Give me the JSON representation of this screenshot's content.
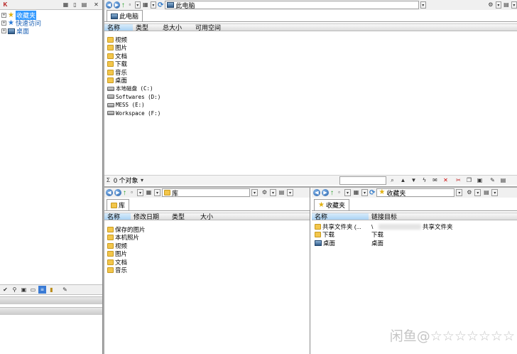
{
  "left_panel": {
    "tree": [
      {
        "label": "收藏夹",
        "icon": "star-icon",
        "selected": true
      },
      {
        "label": "快速访问",
        "icon": "quick-access-icon"
      },
      {
        "label": "桌面",
        "icon": "desktop-icon"
      }
    ]
  },
  "top_pane": {
    "address": "此电脑",
    "tab_label": "此电脑",
    "columns": [
      "名称",
      "类型",
      "总大小",
      "可用空间"
    ],
    "items": [
      {
        "name": "视频",
        "icon": "folder"
      },
      {
        "name": "图片",
        "icon": "folder"
      },
      {
        "name": "文档",
        "icon": "folder"
      },
      {
        "name": "下载",
        "icon": "folder"
      },
      {
        "name": "音乐",
        "icon": "folder"
      },
      {
        "name": "桌面",
        "icon": "folder"
      },
      {
        "name": "本地磁盘 (C:)",
        "icon": "drive"
      },
      {
        "name": "Softwares (D:)",
        "icon": "drive"
      },
      {
        "name": "MESS (E:)",
        "icon": "drive"
      },
      {
        "name": "Workspace (F:)",
        "icon": "drive"
      }
    ],
    "status": "0 个对象"
  },
  "bottom_left_pane": {
    "address": "库",
    "tab_label": "库",
    "columns": [
      "名称",
      "修改日期",
      "类型",
      "大小"
    ],
    "items": [
      "保存的图片",
      "本机照片",
      "视频",
      "图片",
      "文档",
      "音乐"
    ]
  },
  "bottom_right_pane": {
    "address": "收藏夹",
    "tab_label": "收藏夹",
    "columns": [
      "名称",
      "链接目标"
    ],
    "items": [
      {
        "name": "共享文件夹 (...",
        "target": "\\",
        "target_suffix": "共享文件夹"
      },
      {
        "name": "下载",
        "target": "下载"
      },
      {
        "name": "桌面",
        "target": "桌面"
      }
    ]
  },
  "watermark": "闲鱼@☆☆☆☆☆☆☆",
  "colors": {
    "selected_bg": "#3399ff",
    "header_active": "#a9d1f3",
    "folder": "#f3c64b"
  }
}
